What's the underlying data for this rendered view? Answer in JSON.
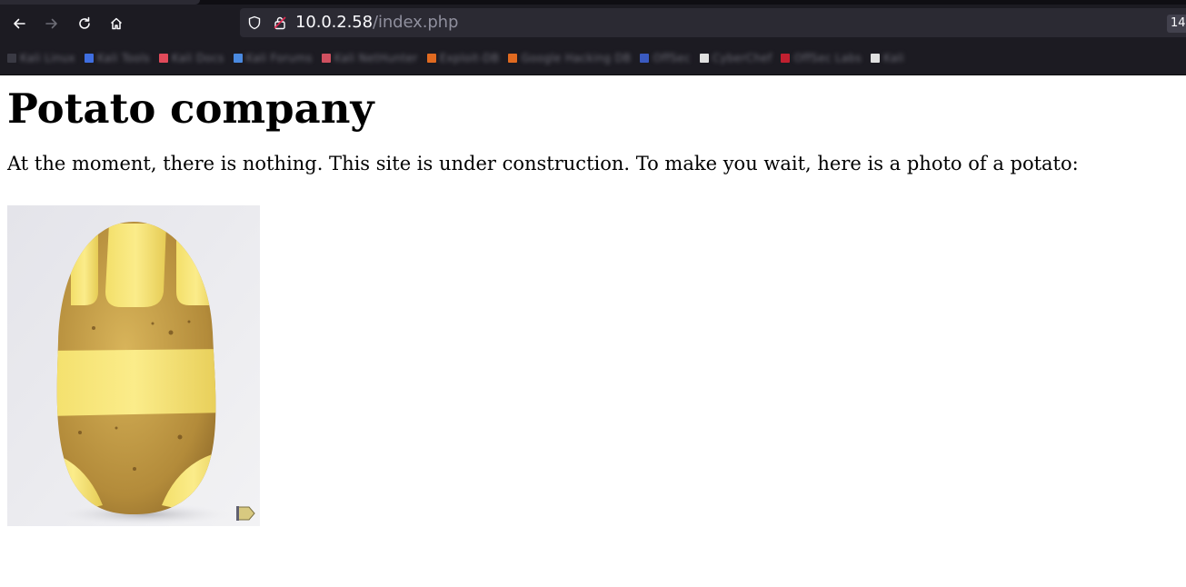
{
  "browser": {
    "url_host": "10.0.2.58",
    "url_path": "/index.php",
    "tab_count": "14",
    "bookmarks": [
      {
        "label": "Kali Linux",
        "color": "#3a3a44"
      },
      {
        "label": "Kali Tools",
        "color": "#3f6ee0"
      },
      {
        "label": "Kali Docs",
        "color": "#e04a5a"
      },
      {
        "label": "Kali Forums",
        "color": "#4a8ae0"
      },
      {
        "label": "Kali NetHunter",
        "color": "#d05060"
      },
      {
        "label": "Exploit-DB",
        "color": "#e06a20"
      },
      {
        "label": "Google Hacking DB",
        "color": "#e06a20"
      },
      {
        "label": "OffSec",
        "color": "#3a5ac0"
      },
      {
        "label": "CyberChef",
        "color": "#e0e0e0"
      },
      {
        "label": "OffSec Labs",
        "color": "#c02030"
      },
      {
        "label": "Kali",
        "color": "#e0e0e0"
      }
    ],
    "icons": [
      "back-icon",
      "forward-icon",
      "reload-icon",
      "home-icon",
      "shield-icon",
      "lock-icon"
    ]
  },
  "page": {
    "heading": "Potato company",
    "intro": "At the moment, there is nothing. This site is under construction. To make you wait, here is a photo of a potato:",
    "image_alt": "photo of a potato"
  }
}
